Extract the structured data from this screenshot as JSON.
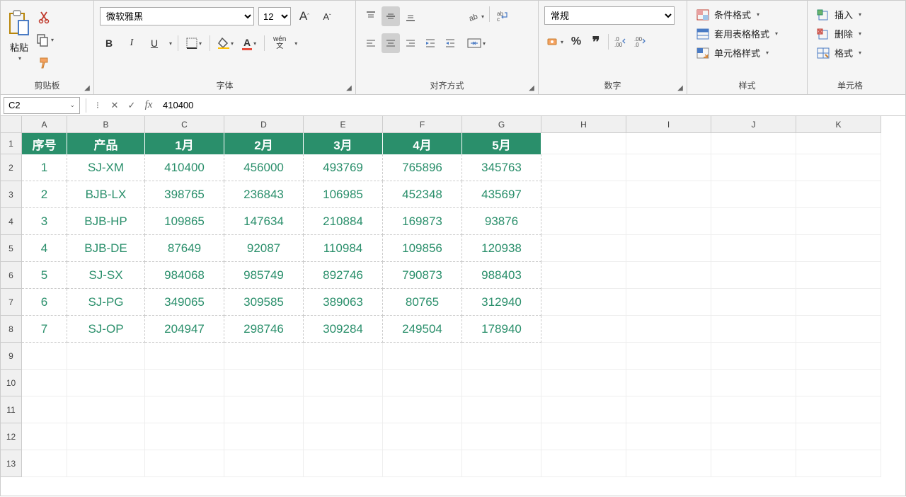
{
  "ribbon": {
    "clipboard": {
      "label": "剪贴板",
      "paste": "粘贴"
    },
    "font": {
      "label": "字体",
      "name": "微软雅黑",
      "size": "12",
      "bold": "B",
      "italic": "I",
      "underline": "U",
      "pinyin": "wén"
    },
    "align": {
      "label": "对齐方式",
      "wrap": "ab"
    },
    "number": {
      "label": "数字",
      "format": "常规",
      "percent": "%",
      "comma": ","
    },
    "styles": {
      "label": "样式",
      "cond": "条件格式",
      "table": "套用表格格式",
      "cell": "单元格样式"
    },
    "cells": {
      "label": "单元格",
      "insert": "插入",
      "delete": "删除",
      "format": "格式"
    }
  },
  "formula_bar": {
    "cell_ref": "C2",
    "value": "410400"
  },
  "columns": [
    "A",
    "B",
    "C",
    "D",
    "E",
    "F",
    "G",
    "H",
    "I",
    "J",
    "K"
  ],
  "col_widths": [
    "cA",
    "cB",
    "cC",
    "cD",
    "cE",
    "cF",
    "cG",
    "cH",
    "cI",
    "cJ",
    "cK"
  ],
  "table": {
    "headers": [
      "序号",
      "产品",
      "1月",
      "2月",
      "3月",
      "4月",
      "5月"
    ],
    "rows": [
      [
        "1",
        "SJ-XM",
        "410400",
        "456000",
        "493769",
        "765896",
        "345763"
      ],
      [
        "2",
        "BJB-LX",
        "398765",
        "236843",
        "106985",
        "452348",
        "435697"
      ],
      [
        "3",
        "BJB-HP",
        "109865",
        "147634",
        "210884",
        "169873",
        "93876"
      ],
      [
        "4",
        "BJB-DE",
        "87649",
        "92087",
        "110984",
        "109856",
        "120938"
      ],
      [
        "5",
        "SJ-SX",
        "984068",
        "985749",
        "892746",
        "790873",
        "988403"
      ],
      [
        "6",
        "SJ-PG",
        "349065",
        "309585",
        "389063",
        "80765",
        "312940"
      ],
      [
        "7",
        "SJ-OP",
        "204947",
        "298746",
        "309284",
        "249504",
        "178940"
      ]
    ]
  },
  "row_nums": [
    "1",
    "2",
    "3",
    "4",
    "5",
    "6",
    "7",
    "8",
    "9",
    "10",
    "11",
    "12",
    "13"
  ]
}
